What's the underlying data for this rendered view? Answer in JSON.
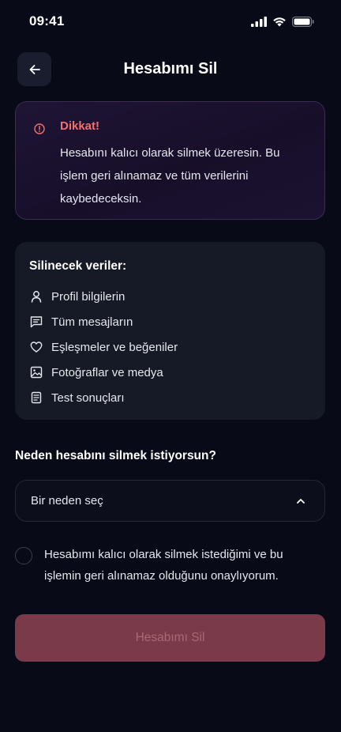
{
  "status_bar": {
    "time": "09:41"
  },
  "header": {
    "title": "Hesabımı Sil"
  },
  "warning": {
    "title": "Dikkat!",
    "line1": "Hesabını kalıcı olarak silmek üzeresin. Bu",
    "line2": "işlem geri alınamaz ve tüm verilerini",
    "line3": "kaybedeceksin."
  },
  "data_card": {
    "title": "Silinecek veriler:",
    "items": [
      {
        "icon": "user-icon",
        "label": "Profil bilgilerin"
      },
      {
        "icon": "message-icon",
        "label": "Tüm mesajların"
      },
      {
        "icon": "heart-icon",
        "label": "Eşleşmeler ve beğeniler"
      },
      {
        "icon": "image-icon",
        "label": "Fotoğraflar ve medya"
      },
      {
        "icon": "document-icon",
        "label": "Test sonuçları"
      }
    ]
  },
  "reason": {
    "label": "Neden hesabını silmek istiyorsun?",
    "selected": "Bir neden seç"
  },
  "consent": {
    "line1": "Hesabımı kalıcı olarak silmek istediğimi ve bu",
    "line2": "işlemin geri alınamaz olduğunu onaylıyorum."
  },
  "delete_button": {
    "label": "Hesabımı Sil"
  },
  "colors": {
    "background": "#080a18",
    "warning_accent": "#f2706f",
    "card": "#161926",
    "button_disabled": "#7a3a4a"
  }
}
